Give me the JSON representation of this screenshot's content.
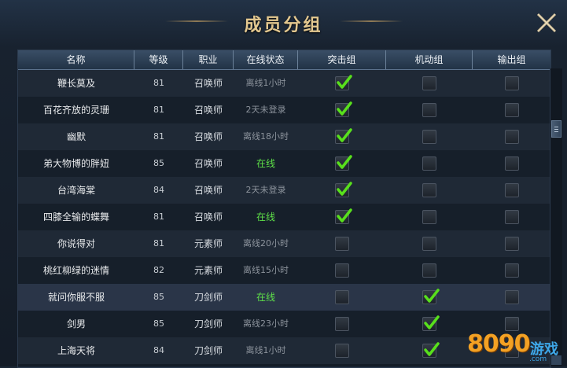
{
  "window": {
    "title": "成员分组"
  },
  "table": {
    "headers": [
      "名称",
      "等级",
      "职业",
      "在线状态",
      "突击组",
      "机动组",
      "输出组"
    ],
    "rows": [
      {
        "name": "鞭长莫及",
        "level": "81",
        "job": "召唤师",
        "status": "离线1小时",
        "online": false,
        "assault": true,
        "mobile": false,
        "output": false
      },
      {
        "name": "百花齐放的灵珊",
        "level": "81",
        "job": "召唤师",
        "status": "2天未登录",
        "online": false,
        "assault": true,
        "mobile": false,
        "output": false
      },
      {
        "name": "幽默",
        "level": "81",
        "job": "召唤师",
        "status": "离线18小时",
        "online": false,
        "assault": true,
        "mobile": false,
        "output": false
      },
      {
        "name": "弟大物博的胖妞",
        "level": "85",
        "job": "召唤师",
        "status": "在线",
        "online": true,
        "assault": true,
        "mobile": false,
        "output": false
      },
      {
        "name": "台湾海棠",
        "level": "84",
        "job": "召唤师",
        "status": "2天未登录",
        "online": false,
        "assault": true,
        "mobile": false,
        "output": false
      },
      {
        "name": "四膝全输的蝶舞",
        "level": "81",
        "job": "召唤师",
        "status": "在线",
        "online": true,
        "assault": true,
        "mobile": false,
        "output": false
      },
      {
        "name": "你说得对",
        "level": "81",
        "job": "元素师",
        "status": "离线20小时",
        "online": false,
        "assault": false,
        "mobile": false,
        "output": false
      },
      {
        "name": "桃红柳绿的迷情",
        "level": "82",
        "job": "元素师",
        "status": "离线15小时",
        "online": false,
        "assault": false,
        "mobile": false,
        "output": false
      },
      {
        "name": "就问你服不服",
        "level": "85",
        "job": "刀剑师",
        "status": "在线",
        "online": true,
        "assault": false,
        "mobile": true,
        "output": false
      },
      {
        "name": "剑男",
        "level": "85",
        "job": "刀剑师",
        "status": "离线23小时",
        "online": false,
        "assault": false,
        "mobile": true,
        "output": false
      },
      {
        "name": "上海天将",
        "level": "84",
        "job": "刀剑师",
        "status": "离线1小时",
        "online": false,
        "assault": false,
        "mobile": true,
        "output": false
      }
    ]
  },
  "watermark": {
    "brand": "8090",
    "suffix": "游戏",
    "domain": ".com"
  },
  "colors": {
    "online": "#5ee048",
    "offline": "#8c939c",
    "title": "#e3c890",
    "check": "#58e01c"
  }
}
